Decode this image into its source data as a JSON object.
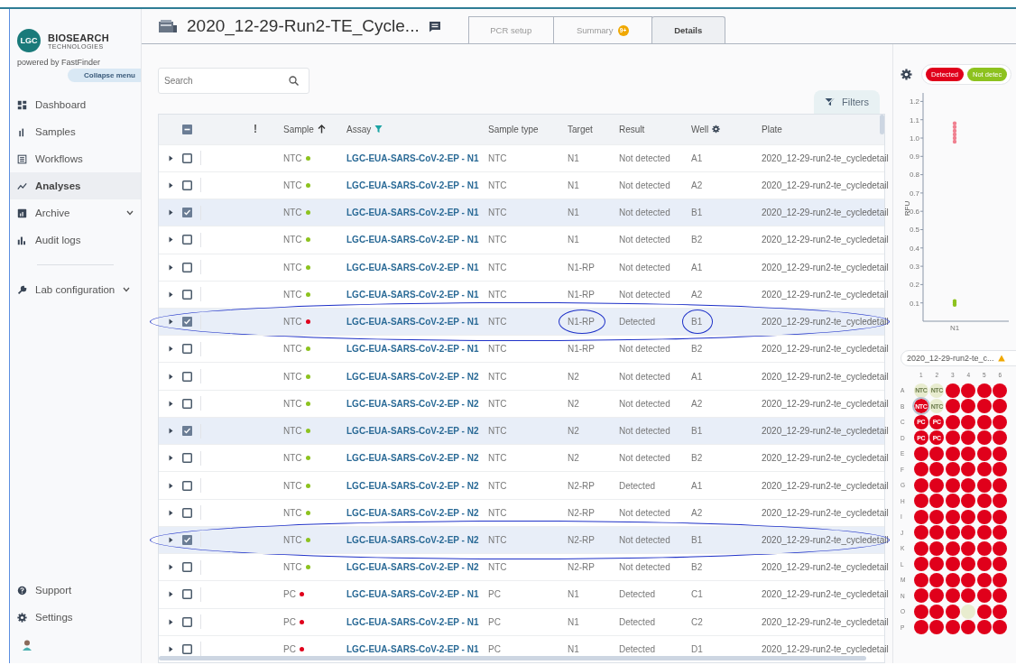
{
  "sidebar": {
    "logo_mark": "LGC",
    "brand": "BIOSEARCH",
    "brand_sub": "TECHNOLOGIES",
    "powered_by": "powered by FastFinder",
    "collapse": "Collapse menu",
    "items": [
      {
        "label": "Dashboard",
        "selected": false,
        "expandable": false
      },
      {
        "label": "Samples",
        "selected": false,
        "expandable": false
      },
      {
        "label": "Workflows",
        "selected": false,
        "expandable": false
      },
      {
        "label": "Analyses",
        "selected": true,
        "expandable": false
      },
      {
        "label": "Archive",
        "selected": false,
        "expandable": true
      },
      {
        "label": "Audit logs",
        "selected": false,
        "expandable": false
      }
    ],
    "config_item": {
      "label": "Lab configuration",
      "expandable": true
    },
    "bottom_items": [
      {
        "label": "Support"
      },
      {
        "label": "Settings"
      }
    ]
  },
  "header": {
    "title": "2020_12-29-Run2-TE_Cycle...",
    "tabs": [
      {
        "label": "PCR setup",
        "selected": false
      },
      {
        "label": "Summary",
        "badge": "9+",
        "selected": false
      },
      {
        "label": "Details",
        "selected": true
      }
    ]
  },
  "search": {
    "placeholder": "Search"
  },
  "filters_button": "Filters",
  "table": {
    "header_checkbox": {
      "indeterminate": true
    },
    "columns": [
      {
        "label": "!",
        "kind": "flag"
      },
      {
        "label": "Sample",
        "kind": "sort"
      },
      {
        "label": "Assay",
        "kind": "filter"
      },
      {
        "label": "Sample type",
        "kind": "plain"
      },
      {
        "label": "Target",
        "kind": "plain"
      },
      {
        "label": "Result",
        "kind": "plain"
      },
      {
        "label": "Well",
        "kind": "settings"
      },
      {
        "label": "Plate",
        "kind": "plain"
      }
    ],
    "rows": [
      {
        "checked": false,
        "sample": "NTC",
        "color": "#8dc21f",
        "assay": "LGC-EUA-SARS-CoV-2-EP - N1",
        "sample_type": "NTC",
        "target": "N1",
        "result": "Not detected",
        "well": "A1",
        "plate": "2020_12-29-run2-te_cycledetail",
        "circled": false,
        "target_circled": false,
        "well_circled": false
      },
      {
        "checked": false,
        "sample": "NTC",
        "color": "#8dc21f",
        "assay": "LGC-EUA-SARS-CoV-2-EP - N1",
        "sample_type": "NTC",
        "target": "N1",
        "result": "Not detected",
        "well": "A2",
        "plate": "2020_12-29-run2-te_cycledetail",
        "circled": false,
        "target_circled": false,
        "well_circled": false
      },
      {
        "checked": true,
        "sample": "NTC",
        "color": "#8dc21f",
        "assay": "LGC-EUA-SARS-CoV-2-EP - N1",
        "sample_type": "NTC",
        "target": "N1",
        "result": "Not detected",
        "well": "B1",
        "plate": "2020_12-29-run2-te_cycledetail",
        "circled": false,
        "target_circled": false,
        "well_circled": false
      },
      {
        "checked": false,
        "sample": "NTC",
        "color": "#8dc21f",
        "assay": "LGC-EUA-SARS-CoV-2-EP - N1",
        "sample_type": "NTC",
        "target": "N1",
        "result": "Not detected",
        "well": "B2",
        "plate": "2020_12-29-run2-te_cycledetail",
        "circled": false,
        "target_circled": false,
        "well_circled": false
      },
      {
        "checked": false,
        "sample": "NTC",
        "color": "#8dc21f",
        "assay": "LGC-EUA-SARS-CoV-2-EP - N1",
        "sample_type": "NTC",
        "target": "N1-RP",
        "result": "Not detected",
        "well": "A1",
        "plate": "2020_12-29-run2-te_cycledetail",
        "circled": false,
        "target_circled": false,
        "well_circled": false
      },
      {
        "checked": false,
        "sample": "NTC",
        "color": "#8dc21f",
        "assay": "LGC-EUA-SARS-CoV-2-EP - N1",
        "sample_type": "NTC",
        "target": "N1-RP",
        "result": "Not detected",
        "well": "A2",
        "plate": "2020_12-29-run2-te_cycledetail",
        "circled": false,
        "target_circled": false,
        "well_circled": false
      },
      {
        "checked": true,
        "sample": "NTC",
        "color": "#e0001b",
        "assay": "LGC-EUA-SARS-CoV-2-EP - N1",
        "sample_type": "NTC",
        "target": "N1-RP",
        "result": "Detected",
        "well": "B1",
        "plate": "2020_12-29-run2-te_cycledetail",
        "circled": true,
        "target_circled": true,
        "well_circled": true
      },
      {
        "checked": false,
        "sample": "NTC",
        "color": "#8dc21f",
        "assay": "LGC-EUA-SARS-CoV-2-EP - N1",
        "sample_type": "NTC",
        "target": "N1-RP",
        "result": "Not detected",
        "well": "B2",
        "plate": "2020_12-29-run2-te_cycledetail",
        "circled": false,
        "target_circled": false,
        "well_circled": false
      },
      {
        "checked": false,
        "sample": "NTC",
        "color": "#8dc21f",
        "assay": "LGC-EUA-SARS-CoV-2-EP - N2",
        "sample_type": "NTC",
        "target": "N2",
        "result": "Not detected",
        "well": "A1",
        "plate": "2020_12-29-run2-te_cycledetail",
        "circled": false,
        "target_circled": false,
        "well_circled": false
      },
      {
        "checked": false,
        "sample": "NTC",
        "color": "#8dc21f",
        "assay": "LGC-EUA-SARS-CoV-2-EP - N2",
        "sample_type": "NTC",
        "target": "N2",
        "result": "Not detected",
        "well": "A2",
        "plate": "2020_12-29-run2-te_cycledetail",
        "circled": false,
        "target_circled": false,
        "well_circled": false
      },
      {
        "checked": true,
        "sample": "NTC",
        "color": "#8dc21f",
        "assay": "LGC-EUA-SARS-CoV-2-EP - N2",
        "sample_type": "NTC",
        "target": "N2",
        "result": "Not detected",
        "well": "B1",
        "plate": "2020_12-29-run2-te_cycledetail",
        "circled": false,
        "target_circled": false,
        "well_circled": false
      },
      {
        "checked": false,
        "sample": "NTC",
        "color": "#8dc21f",
        "assay": "LGC-EUA-SARS-CoV-2-EP - N2",
        "sample_type": "NTC",
        "target": "N2",
        "result": "Not detected",
        "well": "B2",
        "plate": "2020_12-29-run2-te_cycledetail",
        "circled": false,
        "target_circled": false,
        "well_circled": false
      },
      {
        "checked": false,
        "sample": "NTC",
        "color": "#8dc21f",
        "assay": "LGC-EUA-SARS-CoV-2-EP - N2",
        "sample_type": "NTC",
        "target": "N2-RP",
        "result": "Detected",
        "well": "A1",
        "plate": "2020_12-29-run2-te_cycledetail",
        "circled": false,
        "target_circled": false,
        "well_circled": false
      },
      {
        "checked": false,
        "sample": "NTC",
        "color": "#8dc21f",
        "assay": "LGC-EUA-SARS-CoV-2-EP - N2",
        "sample_type": "NTC",
        "target": "N2-RP",
        "result": "Not detected",
        "well": "A2",
        "plate": "2020_12-29-run2-te_cycledetail",
        "circled": false,
        "target_circled": false,
        "well_circled": false
      },
      {
        "checked": true,
        "sample": "NTC",
        "color": "#8dc21f",
        "assay": "LGC-EUA-SARS-CoV-2-EP - N2",
        "sample_type": "NTC",
        "target": "N2-RP",
        "result": "Not detected",
        "well": "B1",
        "plate": "2020_12-29-run2-te_cycledetail",
        "circled": true,
        "target_circled": false,
        "well_circled": false
      },
      {
        "checked": false,
        "sample": "NTC",
        "color": "#8dc21f",
        "assay": "LGC-EUA-SARS-CoV-2-EP - N2",
        "sample_type": "NTC",
        "target": "N2-RP",
        "result": "Not detected",
        "well": "B2",
        "plate": "2020_12-29-run2-te_cycledetail",
        "circled": false,
        "target_circled": false,
        "well_circled": false
      },
      {
        "checked": false,
        "sample": "PC",
        "color": "#e0001b",
        "assay": "LGC-EUA-SARS-CoV-2-EP - N1",
        "sample_type": "PC",
        "target": "N1",
        "result": "Detected",
        "well": "C1",
        "plate": "2020_12-29-run2-te_cycledetail",
        "circled": false,
        "target_circled": false,
        "well_circled": false
      },
      {
        "checked": false,
        "sample": "PC",
        "color": "#e0001b",
        "assay": "LGC-EUA-SARS-CoV-2-EP - N1",
        "sample_type": "PC",
        "target": "N1",
        "result": "Detected",
        "well": "C2",
        "plate": "2020_12-29-run2-te_cycledetail",
        "circled": false,
        "target_circled": false,
        "well_circled": false
      },
      {
        "checked": false,
        "sample": "PC",
        "color": "#e0001b",
        "assay": "LGC-EUA-SARS-CoV-2-EP - N1",
        "sample_type": "PC",
        "target": "N1",
        "result": "Detected",
        "well": "D1",
        "plate": "2020_12-29-run2-te_cycledetail",
        "circled": false,
        "target_circled": false,
        "well_circled": false
      }
    ]
  },
  "legend": [
    {
      "label": "Detected",
      "color": "#e0001b"
    },
    {
      "label": "Not detec",
      "color": "#8dc21f"
    }
  ],
  "chart": {
    "ylabel": "RFU",
    "category": "N1",
    "ytick_labels": [
      "1.2",
      "1.1",
      "1.0",
      "0.9",
      "0.8",
      "0.7",
      "0.6",
      "0.5",
      "0.4",
      "0.3",
      "0.2",
      "0.1"
    ]
  },
  "plate": {
    "name": "2020_12-29-run2-te_c...",
    "columns": [
      "1",
      "2",
      "3",
      "4",
      "5",
      "6"
    ],
    "rows": [
      {
        "label": "A",
        "wells": [
          {
            "detected": false,
            "label": "NTC",
            "selected": false
          },
          {
            "detected": false,
            "label": "NTC",
            "selected": false
          },
          {
            "detected": true,
            "selected": false
          },
          {
            "detected": true,
            "selected": false
          },
          {
            "detected": true,
            "selected": false
          },
          {
            "detected": true,
            "selected": false
          }
        ]
      },
      {
        "label": "B",
        "wells": [
          {
            "detected": true,
            "label": "NTC",
            "selected": true
          },
          {
            "detected": false,
            "label": "NTC",
            "selected": false
          },
          {
            "detected": true,
            "selected": false
          },
          {
            "detected": true,
            "selected": false
          },
          {
            "detected": true,
            "selected": false
          },
          {
            "detected": true,
            "selected": false
          }
        ]
      },
      {
        "label": "C",
        "wells": [
          {
            "detected": true,
            "label": "PC",
            "selected": false
          },
          {
            "detected": true,
            "label": "PC",
            "selected": false
          },
          {
            "detected": true,
            "selected": false
          },
          {
            "detected": true,
            "selected": false
          },
          {
            "detected": true,
            "selected": false
          },
          {
            "detected": true,
            "selected": false
          }
        ]
      },
      {
        "label": "D",
        "wells": [
          {
            "detected": true,
            "label": "PC",
            "selected": false
          },
          {
            "detected": true,
            "label": "PC",
            "selected": false
          },
          {
            "detected": true,
            "selected": false
          },
          {
            "detected": true,
            "selected": false
          },
          {
            "detected": true,
            "selected": false
          },
          {
            "detected": true,
            "selected": false
          }
        ]
      },
      {
        "label": "E",
        "wells": [
          {
            "detected": true,
            "selected": false
          },
          {
            "detected": true,
            "selected": false
          },
          {
            "detected": true,
            "selected": false
          },
          {
            "detected": true,
            "selected": false
          },
          {
            "detected": true,
            "selected": false
          },
          {
            "detected": true,
            "selected": false
          }
        ]
      },
      {
        "label": "F",
        "wells": [
          {
            "detected": true,
            "selected": false
          },
          {
            "detected": true,
            "selected": false
          },
          {
            "detected": true,
            "selected": false
          },
          {
            "detected": true,
            "selected": false
          },
          {
            "detected": true,
            "selected": false
          },
          {
            "detected": true,
            "selected": false
          }
        ]
      },
      {
        "label": "G",
        "wells": [
          {
            "detected": true,
            "selected": false
          },
          {
            "detected": true,
            "selected": false
          },
          {
            "detected": true,
            "selected": false
          },
          {
            "detected": true,
            "selected": false
          },
          {
            "detected": true,
            "selected": false
          },
          {
            "detected": true,
            "selected": false
          }
        ]
      },
      {
        "label": "H",
        "wells": [
          {
            "detected": true,
            "selected": false
          },
          {
            "detected": true,
            "selected": false
          },
          {
            "detected": true,
            "selected": false
          },
          {
            "detected": true,
            "selected": false
          },
          {
            "detected": true,
            "selected": false
          },
          {
            "detected": true,
            "selected": false
          }
        ]
      },
      {
        "label": "I",
        "wells": [
          {
            "detected": true,
            "selected": false
          },
          {
            "detected": true,
            "selected": false
          },
          {
            "detected": true,
            "selected": false
          },
          {
            "detected": true,
            "selected": false
          },
          {
            "detected": true,
            "selected": false
          },
          {
            "detected": true,
            "selected": false
          }
        ]
      },
      {
        "label": "J",
        "wells": [
          {
            "detected": true,
            "selected": false
          },
          {
            "detected": true,
            "selected": false
          },
          {
            "detected": true,
            "selected": false
          },
          {
            "detected": true,
            "selected": false
          },
          {
            "detected": true,
            "selected": false
          },
          {
            "detected": true,
            "selected": false
          }
        ]
      },
      {
        "label": "K",
        "wells": [
          {
            "detected": true,
            "selected": false
          },
          {
            "detected": true,
            "selected": false
          },
          {
            "detected": true,
            "selected": false
          },
          {
            "detected": true,
            "selected": false
          },
          {
            "detected": true,
            "selected": false
          },
          {
            "detected": true,
            "selected": false
          }
        ]
      },
      {
        "label": "L",
        "wells": [
          {
            "detected": true,
            "selected": false
          },
          {
            "detected": true,
            "selected": false
          },
          {
            "detected": true,
            "selected": false
          },
          {
            "detected": true,
            "selected": false
          },
          {
            "detected": true,
            "selected": false
          },
          {
            "detected": true,
            "selected": false
          }
        ]
      },
      {
        "label": "M",
        "wells": [
          {
            "detected": true,
            "selected": false
          },
          {
            "detected": true,
            "selected": false
          },
          {
            "detected": true,
            "selected": false
          },
          {
            "detected": true,
            "selected": false
          },
          {
            "detected": true,
            "selected": false
          },
          {
            "detected": true,
            "selected": false
          }
        ]
      },
      {
        "label": "N",
        "wells": [
          {
            "detected": true,
            "selected": false
          },
          {
            "detected": true,
            "selected": false
          },
          {
            "detected": true,
            "selected": false
          },
          {
            "detected": true,
            "selected": false
          },
          {
            "detected": true,
            "selected": false
          },
          {
            "detected": true,
            "selected": false
          }
        ]
      },
      {
        "label": "O",
        "wells": [
          {
            "detected": true,
            "selected": false
          },
          {
            "detected": true,
            "selected": false
          },
          {
            "detected": true,
            "selected": false
          },
          {
            "detected": false,
            "selected": false
          },
          {
            "detected": true,
            "selected": false
          },
          {
            "detected": true,
            "selected": false
          }
        ]
      },
      {
        "label": "P",
        "wells": [
          {
            "detected": true,
            "selected": false
          },
          {
            "detected": true,
            "selected": false
          },
          {
            "detected": true,
            "selected": false
          },
          {
            "detected": true,
            "selected": false
          },
          {
            "detected": true,
            "selected": false
          },
          {
            "detected": true,
            "selected": false
          }
        ]
      }
    ]
  }
}
